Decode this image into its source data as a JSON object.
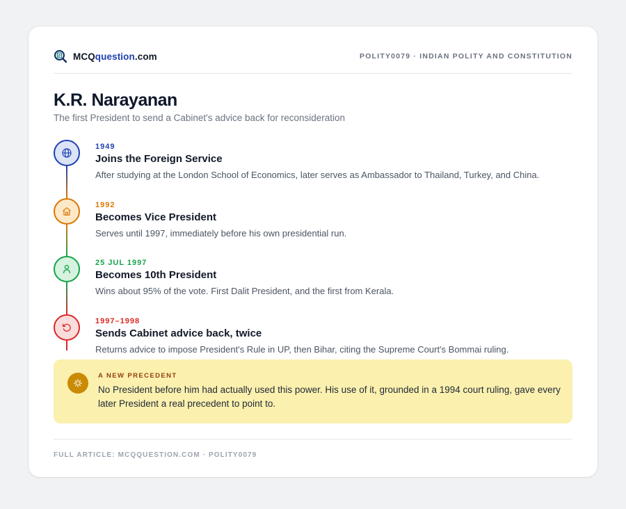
{
  "brand": {
    "prefix": "MCQ",
    "highlight": "question",
    "suffix": ".com"
  },
  "header": {
    "meta": "POLITY0079 · INDIAN POLITY AND CONSTITUTION"
  },
  "title": "K.R. Narayanan",
  "subtitle": "The first President to send a Cabinet's advice back for reconsideration",
  "events": [
    {
      "date": "1949",
      "title": "Joins the Foreign Service",
      "description": "After studying at the London School of Economics, later serves as Ambassador to Thailand, Turkey, and China.",
      "icon": "globe-icon",
      "color": "#1e40af",
      "bg": "#dbe3f7"
    },
    {
      "date": "1992",
      "title": "Becomes Vice President",
      "description": "Serves until 1997, immediately before his own presidential run.",
      "icon": "building-icon",
      "color": "#d97706",
      "bg": "#fde9c8"
    },
    {
      "date": "25 JUL 1997",
      "title": "Becomes 10th President",
      "description": "Wins about 95% of the vote. First Dalit President, and the first from Kerala.",
      "icon": "person-icon",
      "color": "#16a34a",
      "bg": "#d6f3df"
    },
    {
      "date": "1997–1998",
      "title": "Sends Cabinet advice back, twice",
      "description": "Returns advice to impose President's Rule in UP, then Bihar, citing the Supreme Court's Bommai ruling.",
      "icon": "return-arrow-icon",
      "color": "#dc2626",
      "bg": "#fbdcdc"
    }
  ],
  "callout": {
    "label": "A NEW PRECEDENT",
    "text": "No President before him had actually used this power. His use of it, grounded in a 1994 court ruling, gave every later President a real precedent to point to.",
    "icon": "sparkle-icon",
    "color": "#ca8a04"
  },
  "footer": "FULL ARTICLE: MCQQUESTION.COM · POLITY0079"
}
